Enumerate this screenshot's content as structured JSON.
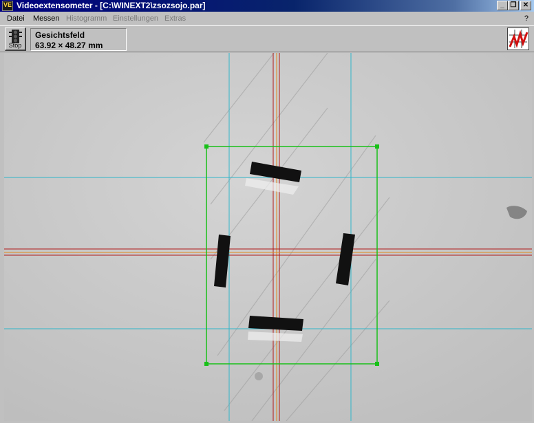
{
  "window": {
    "title": "Videoextensometer - [C:\\WINEXT2\\zsozsojo.par]",
    "controls": {
      "minimize": "_",
      "restore": "❐",
      "close": "✕"
    }
  },
  "menu": [
    {
      "label": "Datei",
      "enabled": true
    },
    {
      "label": "Messen",
      "enabled": true
    },
    {
      "label": "Histogramm",
      "enabled": false
    },
    {
      "label": "Einstellungen",
      "enabled": false
    },
    {
      "label": "Extras",
      "enabled": false
    }
  ],
  "help_menu": "?",
  "toolbar": {
    "stop_label": "Stop",
    "field_title": "Gesichtsfeld",
    "field_value": "63.92 × 48.27 mm"
  },
  "colors": {
    "title_gradient_start": "#000080",
    "cyan_line": "#2fb5c9",
    "red_line": "#b01818",
    "orange_line": "#e08a1a",
    "green_box": "#18c018"
  },
  "icons": [
    "app-icon",
    "traffic-light-icon",
    "chart-icon"
  ]
}
